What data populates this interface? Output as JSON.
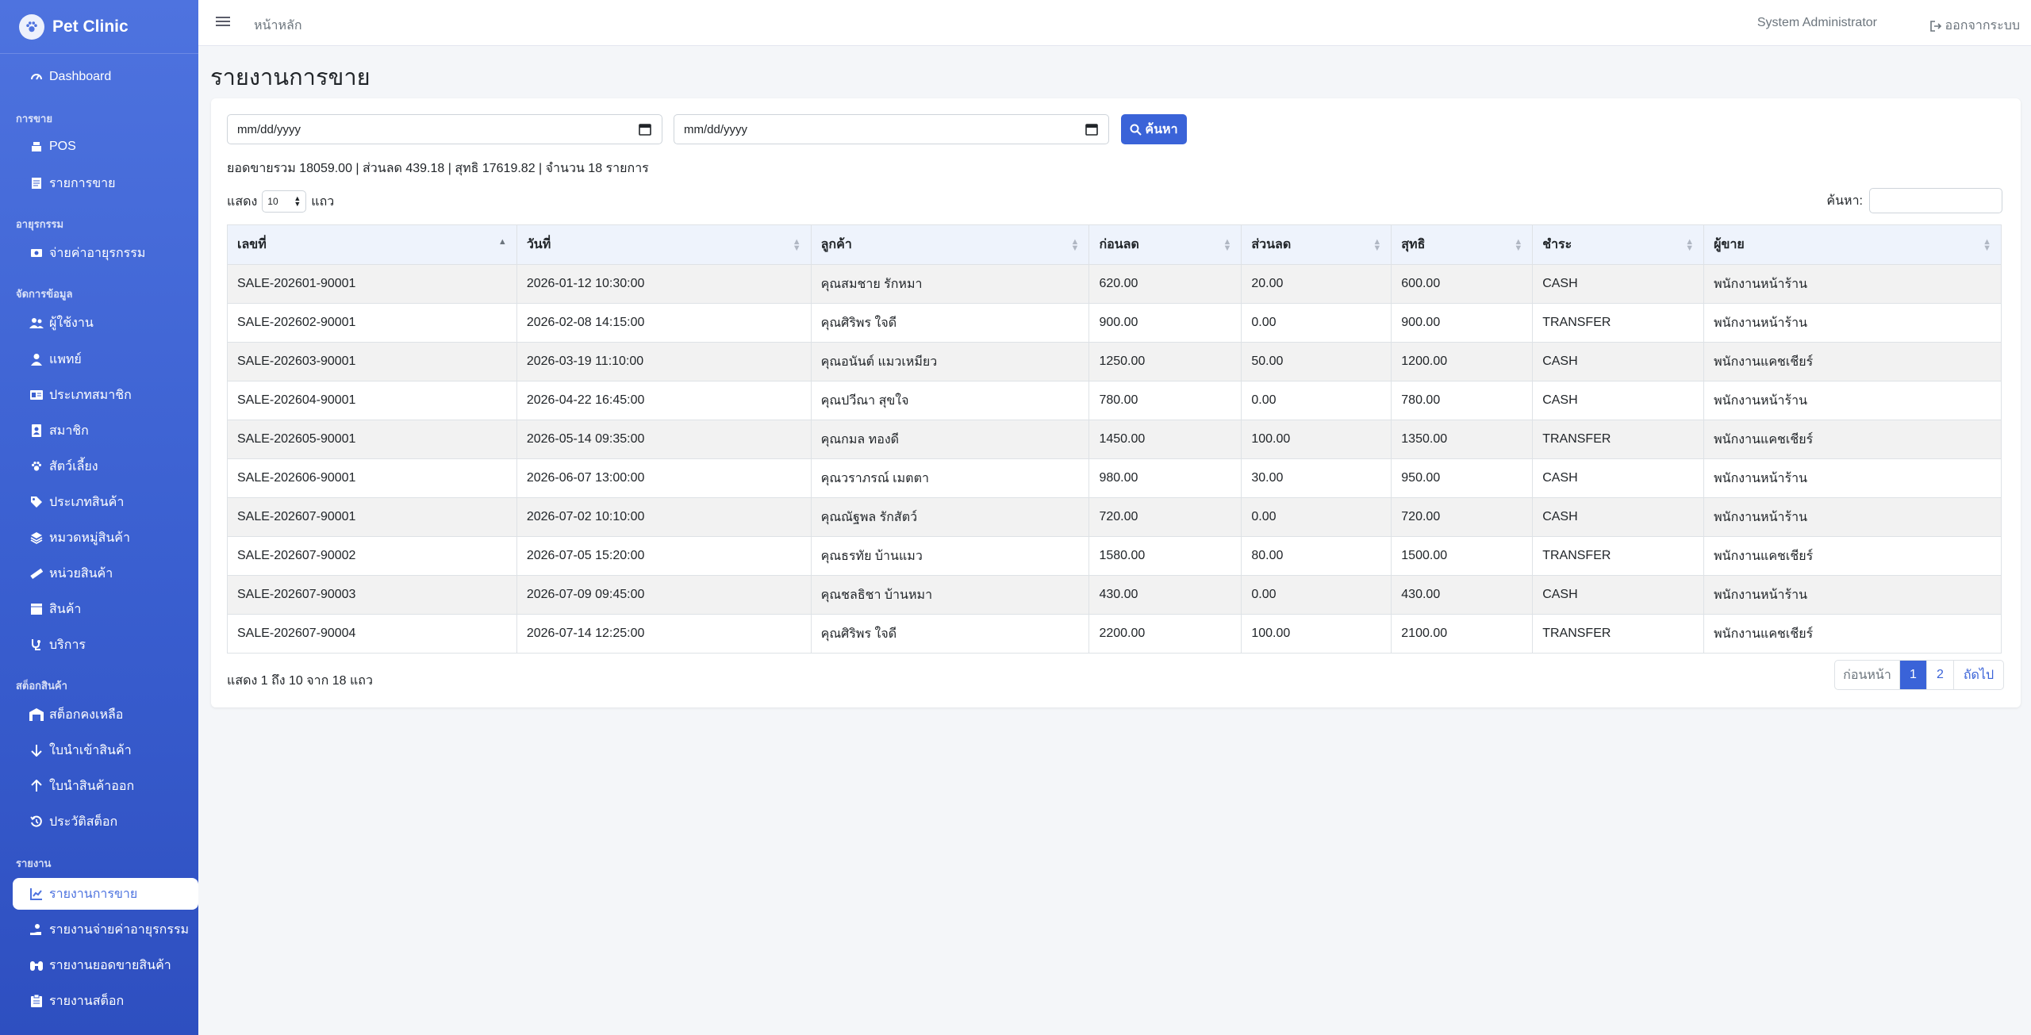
{
  "brand": {
    "name": "Pet Clinic",
    "icon": "paw-icon"
  },
  "sidebar": {
    "dashboard": "Dashboard",
    "sections": [
      {
        "title": "การขาย",
        "items": [
          {
            "label": "POS",
            "icon": "cash-register-icon"
          },
          {
            "label": "รายการขาย",
            "icon": "receipt-icon"
          }
        ]
      },
      {
        "title": "อายุรกรรม",
        "items": [
          {
            "label": "จ่ายค่าอายุรกรรม",
            "icon": "hand-coins-icon"
          }
        ]
      },
      {
        "title": "จัดการข้อมูล",
        "items": [
          {
            "label": "ผู้ใช้งาน",
            "icon": "users-icon"
          },
          {
            "label": "แพทย์",
            "icon": "doctor-icon"
          },
          {
            "label": "ประเภทสมาชิก",
            "icon": "id-card-icon"
          },
          {
            "label": "สมาชิก",
            "icon": "address-book-icon"
          },
          {
            "label": "สัตว์เลี้ยง",
            "icon": "paw-icon"
          },
          {
            "label": "ประเภทสินค้า",
            "icon": "tags-icon"
          },
          {
            "label": "หมวดหมู่สินค้า",
            "icon": "layers-icon"
          },
          {
            "label": "หน่วยสินค้า",
            "icon": "ruler-icon"
          },
          {
            "label": "สินค้า",
            "icon": "box-icon"
          },
          {
            "label": "บริการ",
            "icon": "stethoscope-icon"
          }
        ]
      },
      {
        "title": "สต็อกสินค้า",
        "items": [
          {
            "label": "สต็อกคงเหลือ",
            "icon": "warehouse-icon"
          },
          {
            "label": "ใบนำเข้าสินค้า",
            "icon": "arrow-down-icon"
          },
          {
            "label": "ใบนำสินค้าออก",
            "icon": "arrow-up-icon"
          },
          {
            "label": "ประวัติสต็อก",
            "icon": "history-icon"
          }
        ]
      },
      {
        "title": "รายงาน",
        "items": [
          {
            "label": "รายงานการขาย",
            "icon": "chart-line-icon",
            "active": true
          },
          {
            "label": "รายงานจ่ายค่าอายุรกรรม",
            "icon": "hand-holding-icon"
          },
          {
            "label": "รายงานยอดขายสินค้า",
            "icon": "binoculars-icon"
          },
          {
            "label": "รายงานสต็อก",
            "icon": "clipboard-icon"
          }
        ]
      }
    ]
  },
  "topbar": {
    "breadcrumb": "หน้าหลัก",
    "user": "System Administrator",
    "logout": "ออกจากระบบ"
  },
  "page": {
    "title": "รายงานการขาย"
  },
  "filters": {
    "date_from_placeholder": "mm/dd/yyyy",
    "date_to_placeholder": "mm/dd/yyyy",
    "search_label": "ค้นหา"
  },
  "summary": "ยอดขายรวม 18059.00 | ส่วนลด 439.18 | สุทธิ 17619.82 | จำนวน 18 รายการ",
  "table_controls": {
    "show_prefix": "แสดง",
    "page_length": "10",
    "show_suffix": "แถว",
    "search_label": "ค้นหา:"
  },
  "table": {
    "columns": [
      "เลขที่",
      "วันที่",
      "ลูกค้า",
      "ก่อนลด",
      "ส่วนลด",
      "สุทธิ",
      "ชำระ",
      "ผู้ขาย"
    ],
    "rows": [
      [
        "SALE-202601-90001",
        "2026-01-12 10:30:00",
        "คุณสมชาย รักหมา",
        "620.00",
        "20.00",
        "600.00",
        "CASH",
        "พนักงานหน้าร้าน"
      ],
      [
        "SALE-202602-90001",
        "2026-02-08 14:15:00",
        "คุณศิริพร ใจดี",
        "900.00",
        "0.00",
        "900.00",
        "TRANSFER",
        "พนักงานหน้าร้าน"
      ],
      [
        "SALE-202603-90001",
        "2026-03-19 11:10:00",
        "คุณอนันต์ แมวเหมียว",
        "1250.00",
        "50.00",
        "1200.00",
        "CASH",
        "พนักงานแคชเชียร์"
      ],
      [
        "SALE-202604-90001",
        "2026-04-22 16:45:00",
        "คุณปวีณา สุขใจ",
        "780.00",
        "0.00",
        "780.00",
        "CASH",
        "พนักงานหน้าร้าน"
      ],
      [
        "SALE-202605-90001",
        "2026-05-14 09:35:00",
        "คุณกมล ทองดี",
        "1450.00",
        "100.00",
        "1350.00",
        "TRANSFER",
        "พนักงานแคชเชียร์"
      ],
      [
        "SALE-202606-90001",
        "2026-06-07 13:00:00",
        "คุณวราภรณ์ เมตตา",
        "980.00",
        "30.00",
        "950.00",
        "CASH",
        "พนักงานหน้าร้าน"
      ],
      [
        "SALE-202607-90001",
        "2026-07-02 10:10:00",
        "คุณณัฐพล รักสัตว์",
        "720.00",
        "0.00",
        "720.00",
        "CASH",
        "พนักงานหน้าร้าน"
      ],
      [
        "SALE-202607-90002",
        "2026-07-05 15:20:00",
        "คุณธรทัย บ้านแมว",
        "1580.00",
        "80.00",
        "1500.00",
        "TRANSFER",
        "พนักงานแคชเชียร์"
      ],
      [
        "SALE-202607-90003",
        "2026-07-09 09:45:00",
        "คุณชลธิชา บ้านหมา",
        "430.00",
        "0.00",
        "430.00",
        "CASH",
        "พนักงานหน้าร้าน"
      ],
      [
        "SALE-202607-90004",
        "2026-07-14 12:25:00",
        "คุณศิริพร ใจดี",
        "2200.00",
        "100.00",
        "2100.00",
        "TRANSFER",
        "พนักงานแคชเชียร์"
      ]
    ]
  },
  "pagination": {
    "info": "แสดง 1 ถึง 10 จาก 18 แถว",
    "prev": "ก่อนหน้า",
    "pages": [
      "1",
      "2"
    ],
    "current": "1",
    "next": "ถัดไป"
  }
}
